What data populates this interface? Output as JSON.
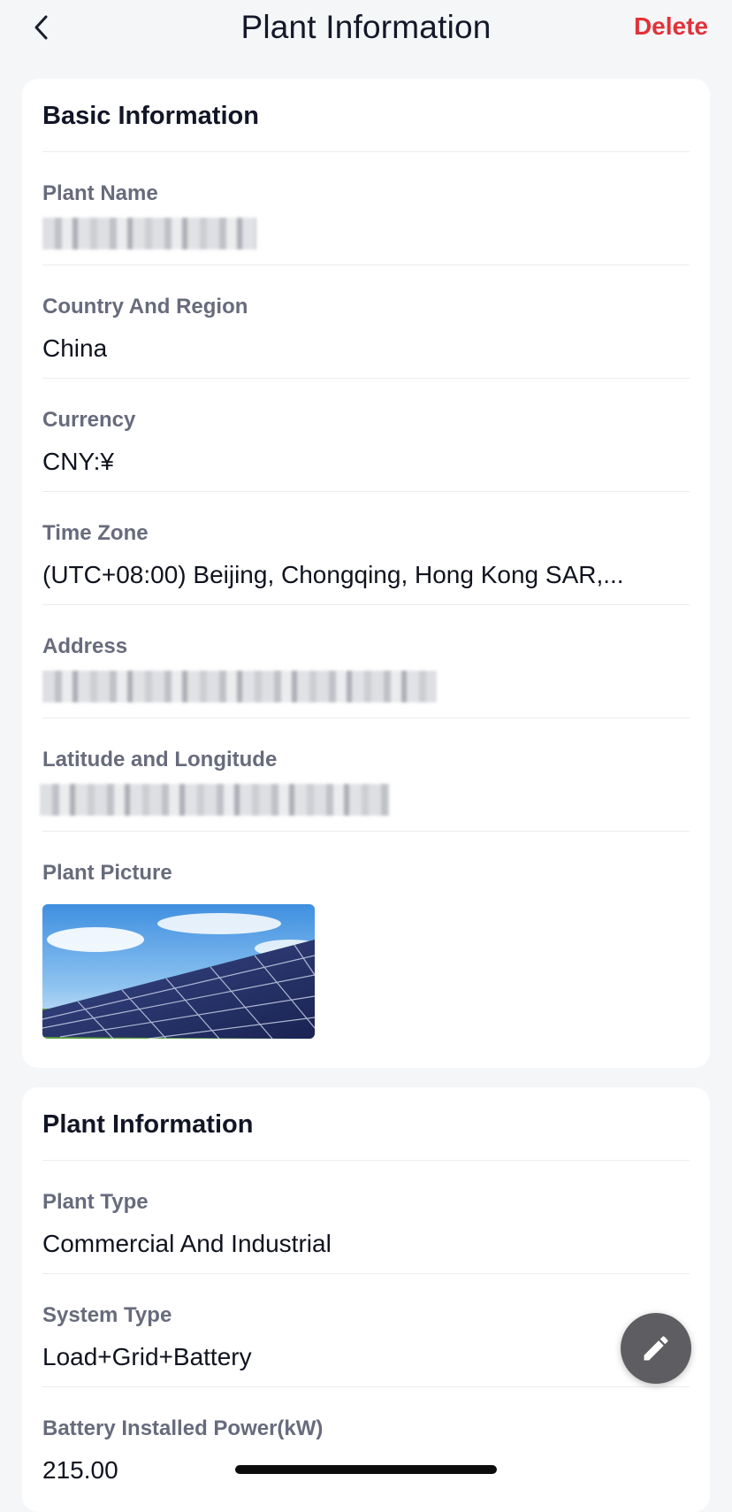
{
  "header": {
    "title": "Plant Information",
    "delete_label": "Delete"
  },
  "basic": {
    "title": "Basic Information",
    "plant_name": {
      "label": "Plant Name",
      "value": ""
    },
    "country": {
      "label": "Country And Region",
      "value": "China"
    },
    "currency": {
      "label": "Currency",
      "value": "CNY:¥"
    },
    "timezone": {
      "label": "Time Zone",
      "value": "(UTC+08:00) Beijing, Chongqing, Hong Kong SAR,..."
    },
    "address": {
      "label": "Address",
      "value": ""
    },
    "latlng": {
      "label": "Latitude and Longitude",
      "value": ""
    },
    "picture": {
      "label": "Plant Picture"
    }
  },
  "plant": {
    "title": "Plant Information",
    "plant_type": {
      "label": "Plant Type",
      "value": "Commercial And Industrial"
    },
    "system_type": {
      "label": "System Type",
      "value": "Load+Grid+Battery"
    },
    "battery_power": {
      "label": "Battery Installed Power(kW)",
      "value": "215.00"
    }
  },
  "colors": {
    "accent_delete": "#e0323a",
    "fab": "#5e5e62",
    "background": "#f5f6f8"
  },
  "icons": {
    "back": "chevron-left-icon",
    "edit": "pencil-icon"
  }
}
